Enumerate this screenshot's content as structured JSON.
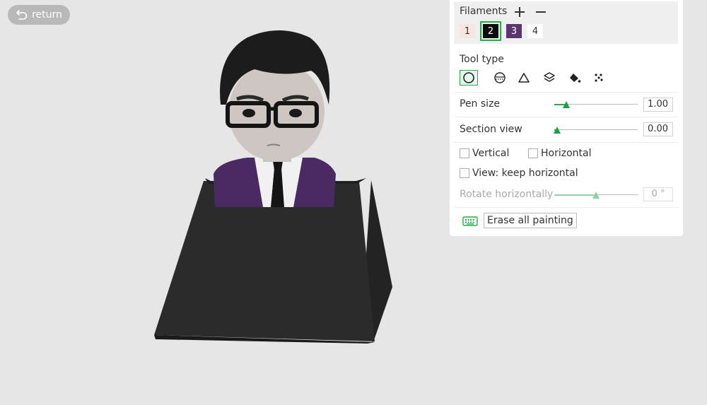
{
  "return_label": "return",
  "filaments": {
    "title": "Filaments",
    "swatches": [
      {
        "label": "1",
        "color": "#f6e6e0"
      },
      {
        "label": "2",
        "color": "#0c0c0c"
      },
      {
        "label": "3",
        "color": "#5b3470"
      },
      {
        "label": "4",
        "color": "#ffffff"
      }
    ],
    "selected": "2"
  },
  "tool_type": {
    "title": "Tool type",
    "tools": [
      "circle-tool",
      "sphere-tool",
      "triangle-tool",
      "height-range-tool",
      "fill-tool",
      "gap-fill-tool"
    ],
    "active": "circle-tool"
  },
  "pen_size": {
    "label": "Pen size",
    "value": "1.00",
    "fraction": 0.14
  },
  "section_view": {
    "label": "Section view",
    "value": "0.00",
    "fraction": 0.03
  },
  "vertical": {
    "label": "Vertical",
    "checked": false
  },
  "horizontal": {
    "label": "Horizontal",
    "checked": false
  },
  "keep_horizontal": {
    "label": "View: keep horizontal",
    "checked": false
  },
  "rotate_horizontally": {
    "label": "Rotate horizontally",
    "value": "0 °",
    "fraction": 0.5
  },
  "erase_all_label": "Erase all painting",
  "colors": {
    "accent": "#22b04a",
    "panel_bg": "#ffffff",
    "viewport_bg": "#e6e6e6"
  }
}
